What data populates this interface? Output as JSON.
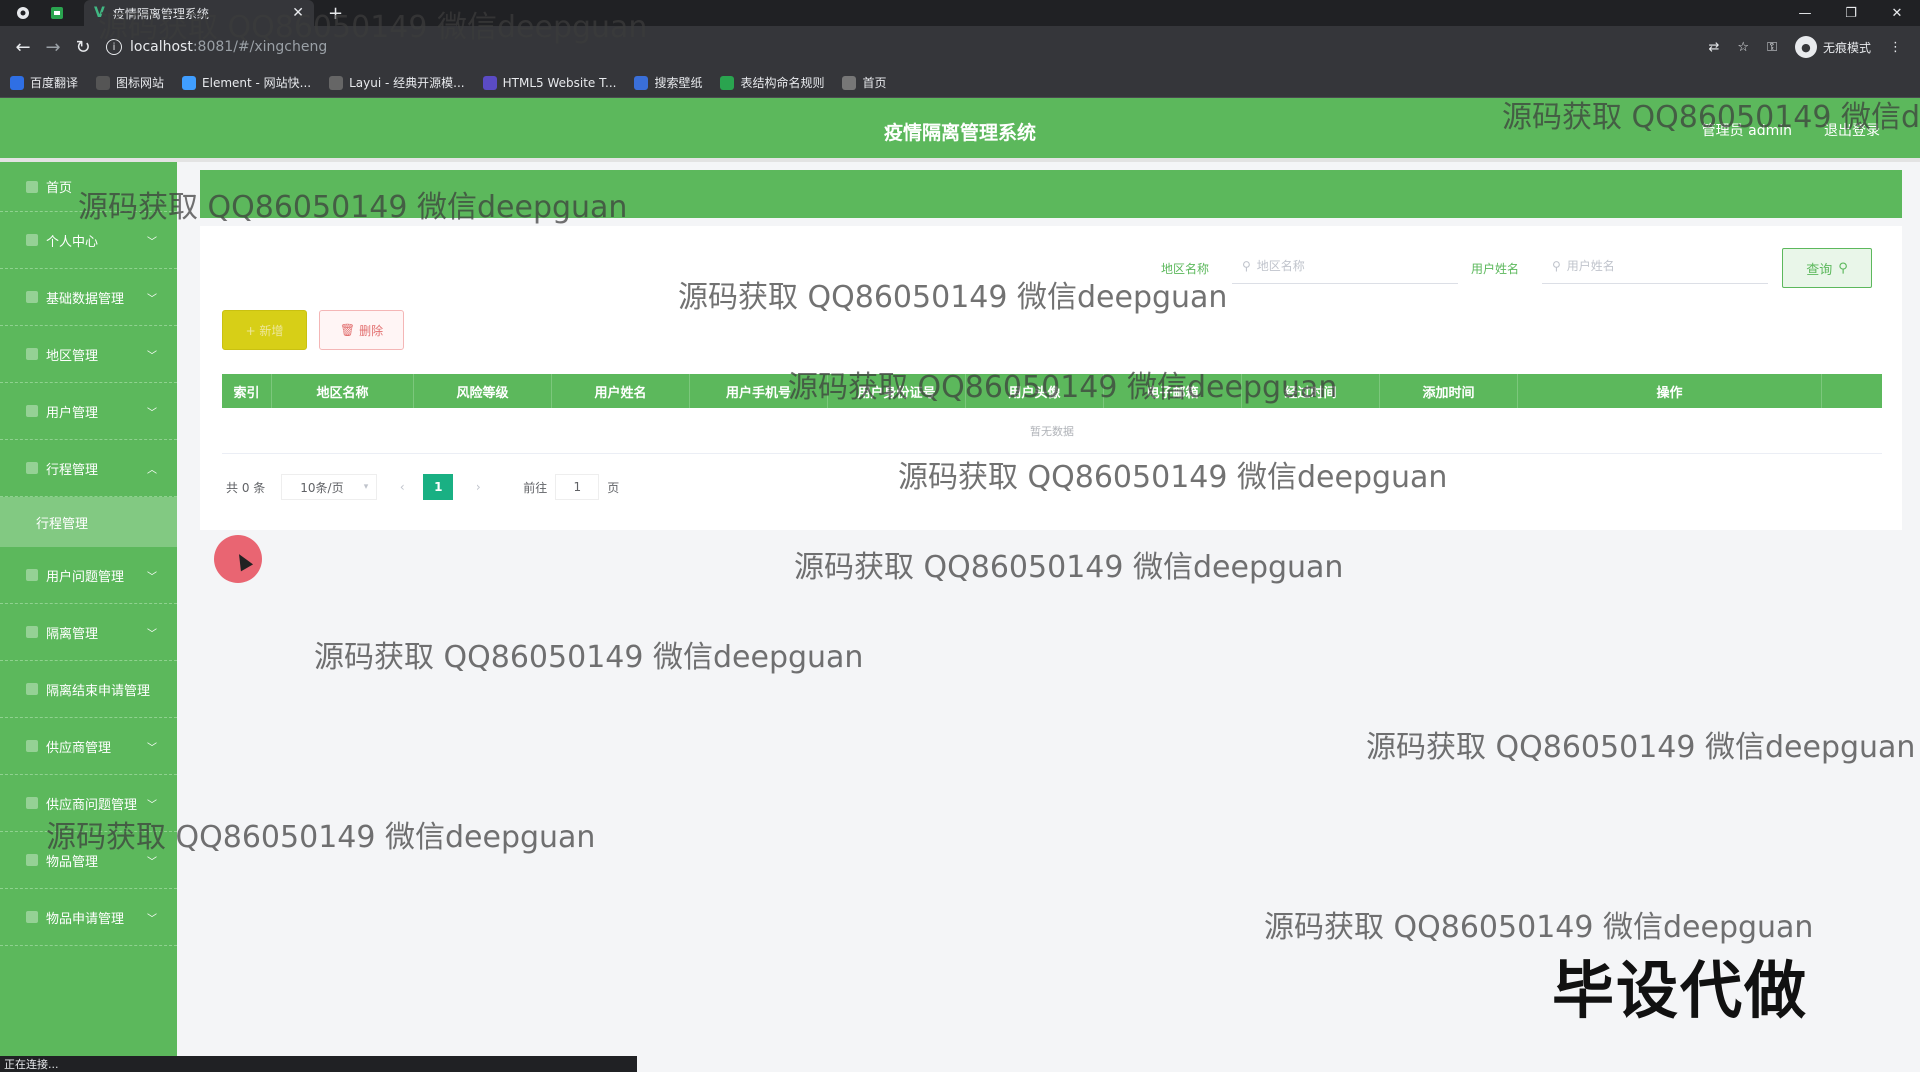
{
  "browser": {
    "tab_title": "疫情隔离管理系统",
    "url_host": "localhost",
    "url_path": ":8081/#/xingcheng",
    "incognito_label": "无痕模式",
    "status_text": "正在连接...",
    "bookmarks": [
      {
        "label": "百度翻译",
        "color": "#2f6fe4"
      },
      {
        "label": "图标网站",
        "color": "#555555"
      },
      {
        "label": "Element - 网站快...",
        "color": "#409eff"
      },
      {
        "label": "Layui - 经典开源模...",
        "color": "#666666"
      },
      {
        "label": "HTML5 Website T...",
        "color": "#5b4bc4"
      },
      {
        "label": "搜索壁纸",
        "color": "#3a6fd8"
      },
      {
        "label": "表结构命名规则",
        "color": "#2aa44f"
      },
      {
        "label": "首页",
        "color": "#777777"
      }
    ]
  },
  "header": {
    "title": "疫情隔离管理系统",
    "user": "管理员 admin",
    "logout": "退出登录",
    "accent": "#5cb85c"
  },
  "sidebar": {
    "items": [
      {
        "label": "首页",
        "chevron": ""
      },
      {
        "label": "个人中心",
        "chevron": "﹀"
      },
      {
        "label": "基础数据管理",
        "chevron": "﹀"
      },
      {
        "label": "地区管理",
        "chevron": "﹀"
      },
      {
        "label": "用户管理",
        "chevron": "﹀"
      },
      {
        "label": "行程管理",
        "chevron": "︿"
      }
    ],
    "sub_item": "行程管理",
    "items2": [
      {
        "label": "用户问题管理",
        "chevron": "﹀"
      },
      {
        "label": "隔离管理",
        "chevron": "﹀"
      },
      {
        "label": "隔离结束申请管理",
        "chevron": ""
      },
      {
        "label": "供应商管理",
        "chevron": "﹀"
      },
      {
        "label": "供应商问题管理",
        "chevron": "﹀"
      },
      {
        "label": "物品管理",
        "chevron": "﹀"
      },
      {
        "label": "物品申请管理",
        "chevron": "﹀"
      }
    ]
  },
  "search": {
    "region_label": "地区名称",
    "region_placeholder": "地区名称",
    "user_label": "用户姓名",
    "user_placeholder": "用户姓名",
    "query_button": "查询"
  },
  "actions": {
    "add": "+ 新增",
    "delete": "删除"
  },
  "table": {
    "columns": [
      "索引",
      "地区名称",
      "风险等级",
      "用户姓名",
      "用户手机号",
      "用户身份证号",
      "用户头像",
      "电子邮箱",
      "经过时间",
      "添加时间",
      "操作"
    ],
    "empty_text": "暂无数据"
  },
  "pagination": {
    "total": "共 0 条",
    "page_size": "10条/页",
    "current_page": "1",
    "goto_prefix": "前往",
    "goto_value": "1",
    "goto_suffix": "页"
  },
  "watermark": {
    "text": "源码获取 QQ86050149 微信deepguan",
    "stamp": "毕设代做"
  }
}
